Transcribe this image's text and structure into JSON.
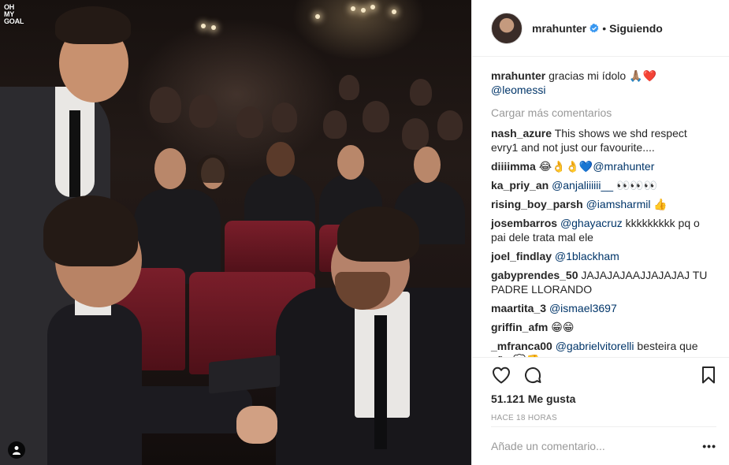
{
  "photo": {
    "logo_lines": [
      "OH",
      "MY",
      "GOAL"
    ]
  },
  "header": {
    "username": "mrahunter",
    "separator": "•",
    "follow_label": "Siguiendo"
  },
  "caption": {
    "username": "mrahunter",
    "text": "gracias mi ídolo 🙏🏽❤️",
    "mention": "@leomessi"
  },
  "load_more_label": "Cargar más comentarios",
  "comments": [
    {
      "user": "nash_azure",
      "mention": "",
      "text": "This shows we shd respect evry1 and not just our favourite...."
    },
    {
      "user": "diiiimma",
      "mention": "@mrahunter",
      "text": "😂👌👌💙",
      "mention_after": true
    },
    {
      "user": "ka_priy_an",
      "mention": "@anjaliiiiii__",
      "text": "👀👀👀"
    },
    {
      "user": "rising_boy_parsh",
      "mention": "@iamsharmil",
      "text": "👍"
    },
    {
      "user": "josembarros",
      "mention": "@ghayacruz",
      "text": "kkkkkkkkk pq o pai dele trata mal ele"
    },
    {
      "user": "joel_findlay",
      "mention": "@1blackham",
      "text": ""
    },
    {
      "user": "gabyprendes_50",
      "mention": "",
      "text": "JAJAJAJAAJJAJAJAJ TU PADRE LLORANDO"
    },
    {
      "user": "maartita_3",
      "mention": "@ismael3697",
      "text": ""
    },
    {
      "user": "griffin_afm",
      "mention": "",
      "text": "😁😁"
    },
    {
      "user": "_mfranca00",
      "mention": "@gabrielvitorelli",
      "text": "besteira que não 💭👎"
    }
  ],
  "likes": "51.121 Me gusta",
  "timestamp": "HACE 18 HORAS",
  "add_comment": {
    "placeholder": "Añade un comentario...",
    "more": "•••"
  },
  "colors": {
    "verified": "#3897f0",
    "mention": "#003569",
    "muted": "#999999",
    "text": "#262626"
  }
}
